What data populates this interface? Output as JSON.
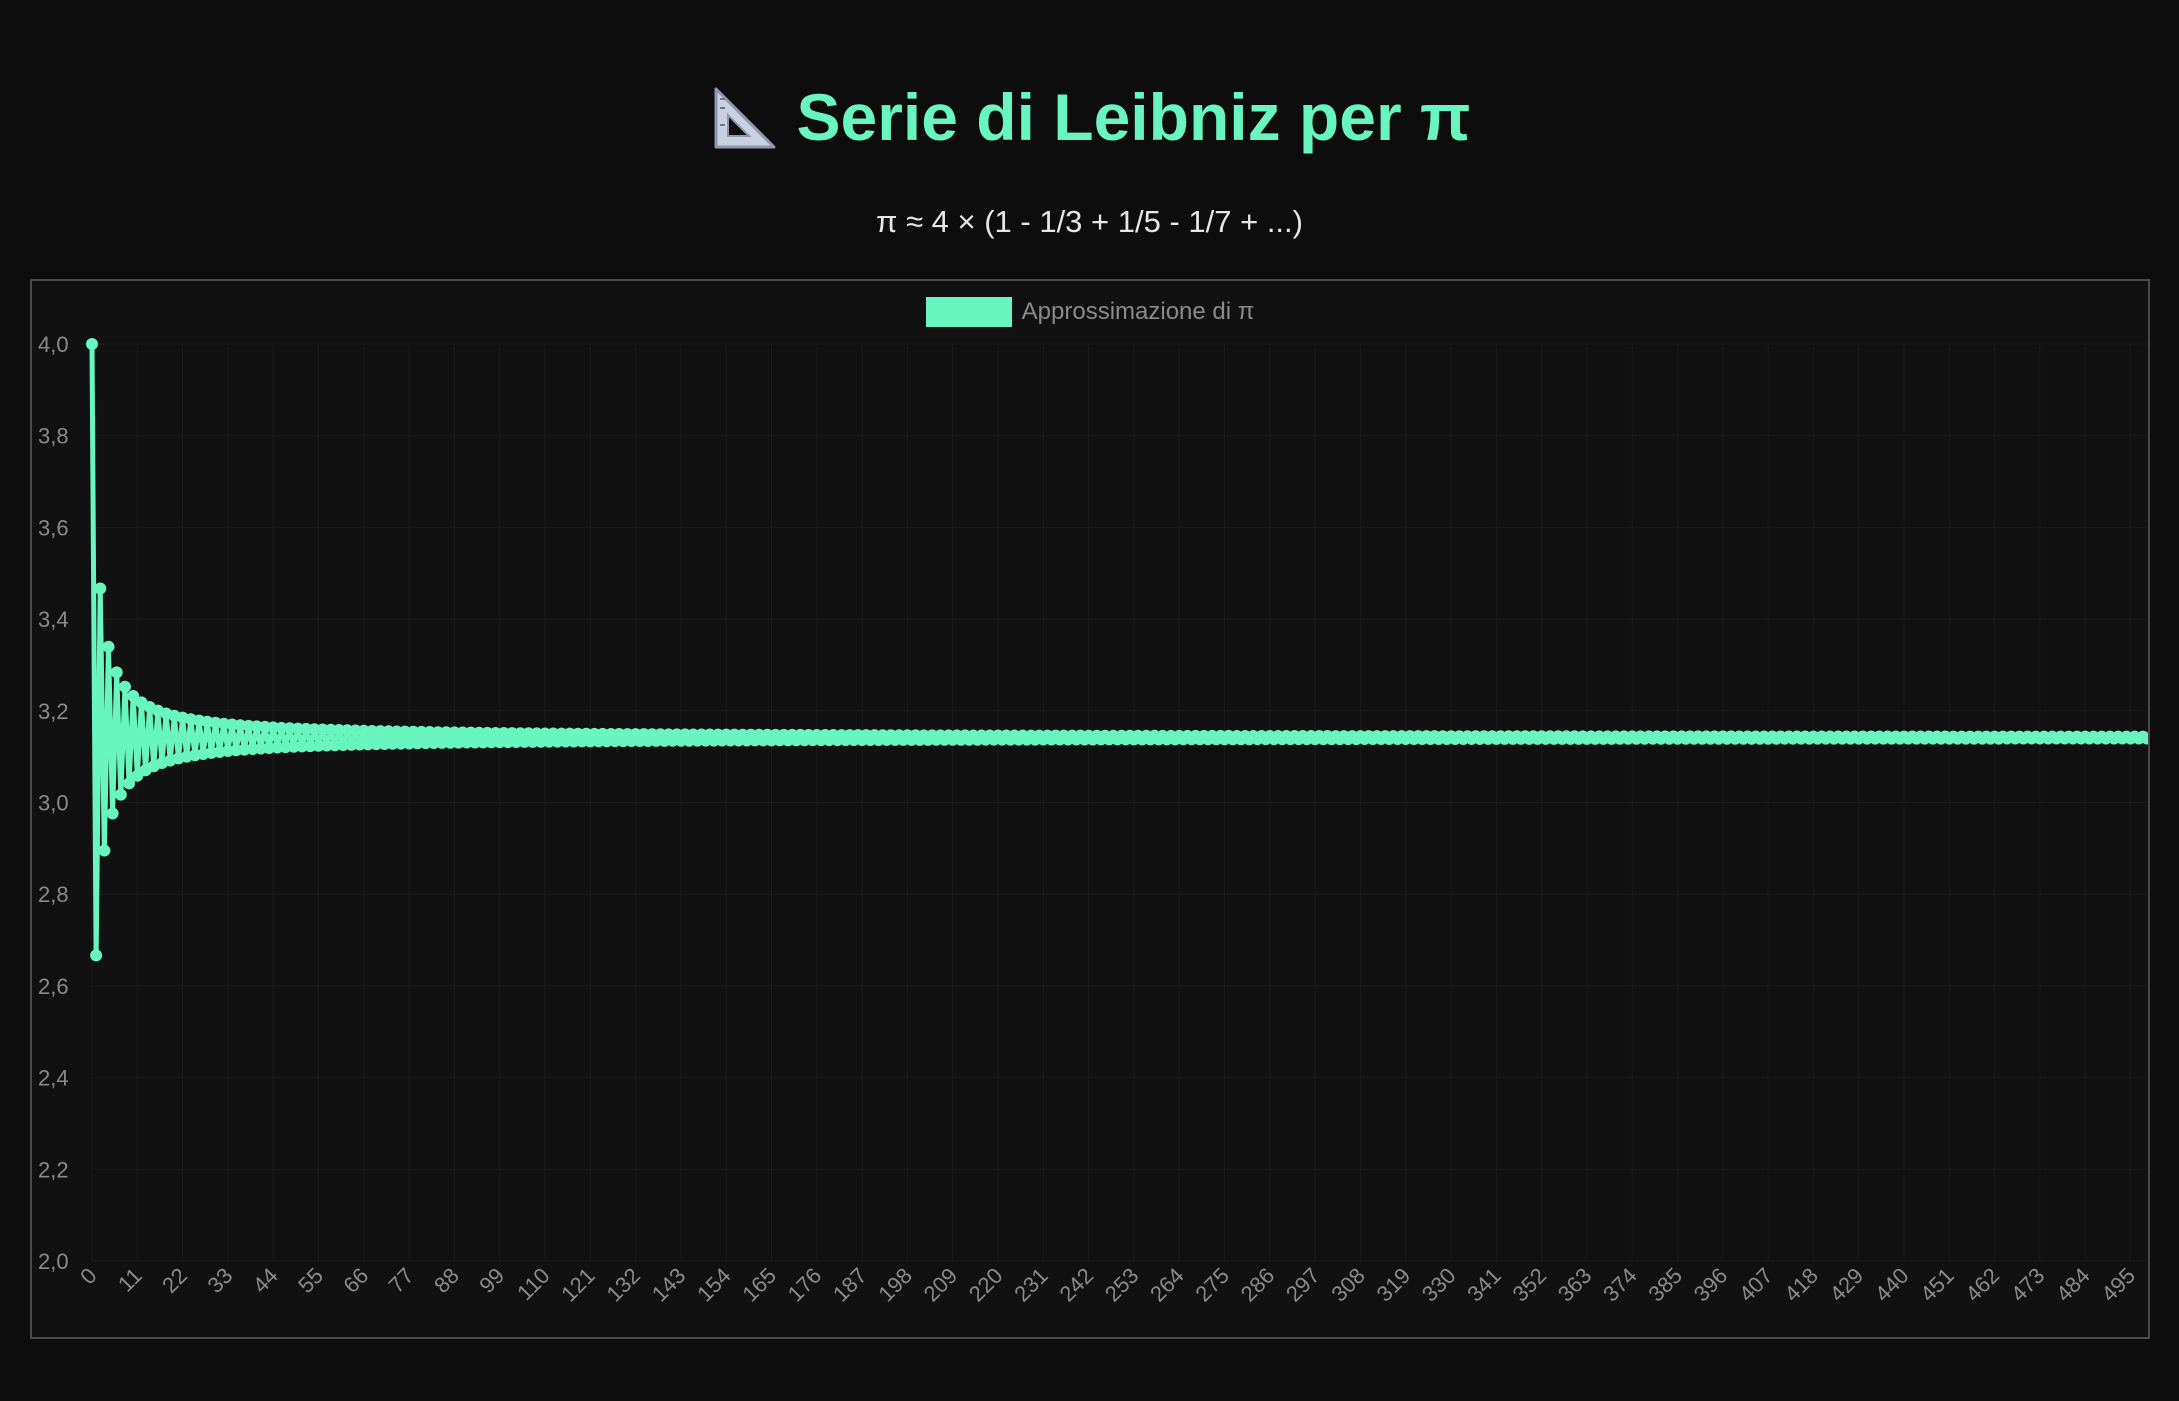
{
  "header": {
    "title": "Serie di Leibniz per π",
    "title_icon": "triangular-ruler-icon",
    "subtitle": "π ≈ 4 × (1 - 1/3 + 1/5 - 1/7 + ...)"
  },
  "colors": {
    "background": "#0d0d0d",
    "accent": "#69f5c0",
    "axis_text": "#8a8a8a",
    "grid": "#1c1c1c"
  },
  "chart_data": {
    "type": "line",
    "series": [
      {
        "name": "Approssimazione di π",
        "formula": "partial sums of 4 × Σ (-1)^k / (2k+1), k = 0 … n",
        "points_count": 500
      }
    ],
    "x": {
      "start": 0,
      "end": 499,
      "tick_step": 11,
      "tick_labels": [
        "0",
        "11",
        "22",
        "33",
        "44",
        "55",
        "66",
        "77",
        "88",
        "99",
        "110",
        "121",
        "132",
        "143",
        "154",
        "165",
        "176",
        "187",
        "198",
        "209",
        "220",
        "231",
        "242",
        "253",
        "264",
        "275",
        "286",
        "297",
        "308",
        "319",
        "330",
        "341",
        "352",
        "363",
        "374",
        "385",
        "396",
        "407",
        "418",
        "429",
        "440",
        "451",
        "462",
        "473",
        "484",
        "495"
      ]
    },
    "y": {
      "range": [
        2.0,
        4.0
      ],
      "tick_labels": [
        "4,0",
        "3,8",
        "3,6",
        "3,4",
        "3,2",
        "3,0",
        "2,8",
        "2,6",
        "2,4",
        "2,2",
        "2,0"
      ]
    },
    "legend": {
      "position": "top-center",
      "label": "Approssimazione di π"
    },
    "grid": true
  }
}
